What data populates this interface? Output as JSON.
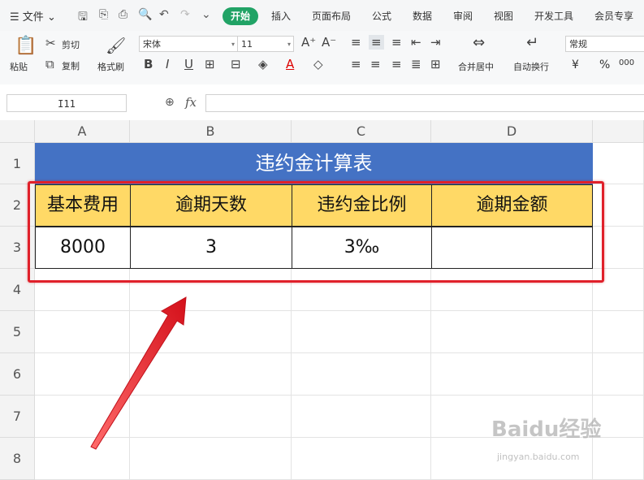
{
  "menubar": {
    "file": "文件",
    "tabs": [
      "开始",
      "插入",
      "页面布局",
      "公式",
      "数据",
      "审阅",
      "视图",
      "开发工具",
      "会员专享"
    ]
  },
  "ribbon": {
    "paste": "粘贴",
    "cut": "剪切",
    "copy": "复制",
    "format_painter": "格式刷",
    "font_name": "宋体",
    "font_size": "11",
    "merge_center": "合并居中",
    "wrap_text": "自动换行",
    "number_format": "常规",
    "currency": "¥",
    "percent": "%",
    "thousands": "000"
  },
  "formula_bar": {
    "cell_ref": "I11",
    "fx": "fx",
    "formula": ""
  },
  "sheet": {
    "columns": [
      "A",
      "B",
      "C",
      "D"
    ],
    "rows": [
      "1",
      "2",
      "3",
      "4",
      "5",
      "6",
      "7",
      "8"
    ],
    "title": "违约金计算表",
    "headers": [
      "基本费用",
      "逾期天数",
      "违约金比例",
      "逾期金额"
    ],
    "values": [
      "8000",
      "3",
      "3‰",
      ""
    ]
  },
  "watermark": {
    "brand": "Baidu经验",
    "url": "jingyan.baidu.com"
  },
  "colors": {
    "title_bg": "#4472c4",
    "header_bg": "#ffd966",
    "accent_green": "#21a366",
    "annotation_red": "#e0202a"
  }
}
